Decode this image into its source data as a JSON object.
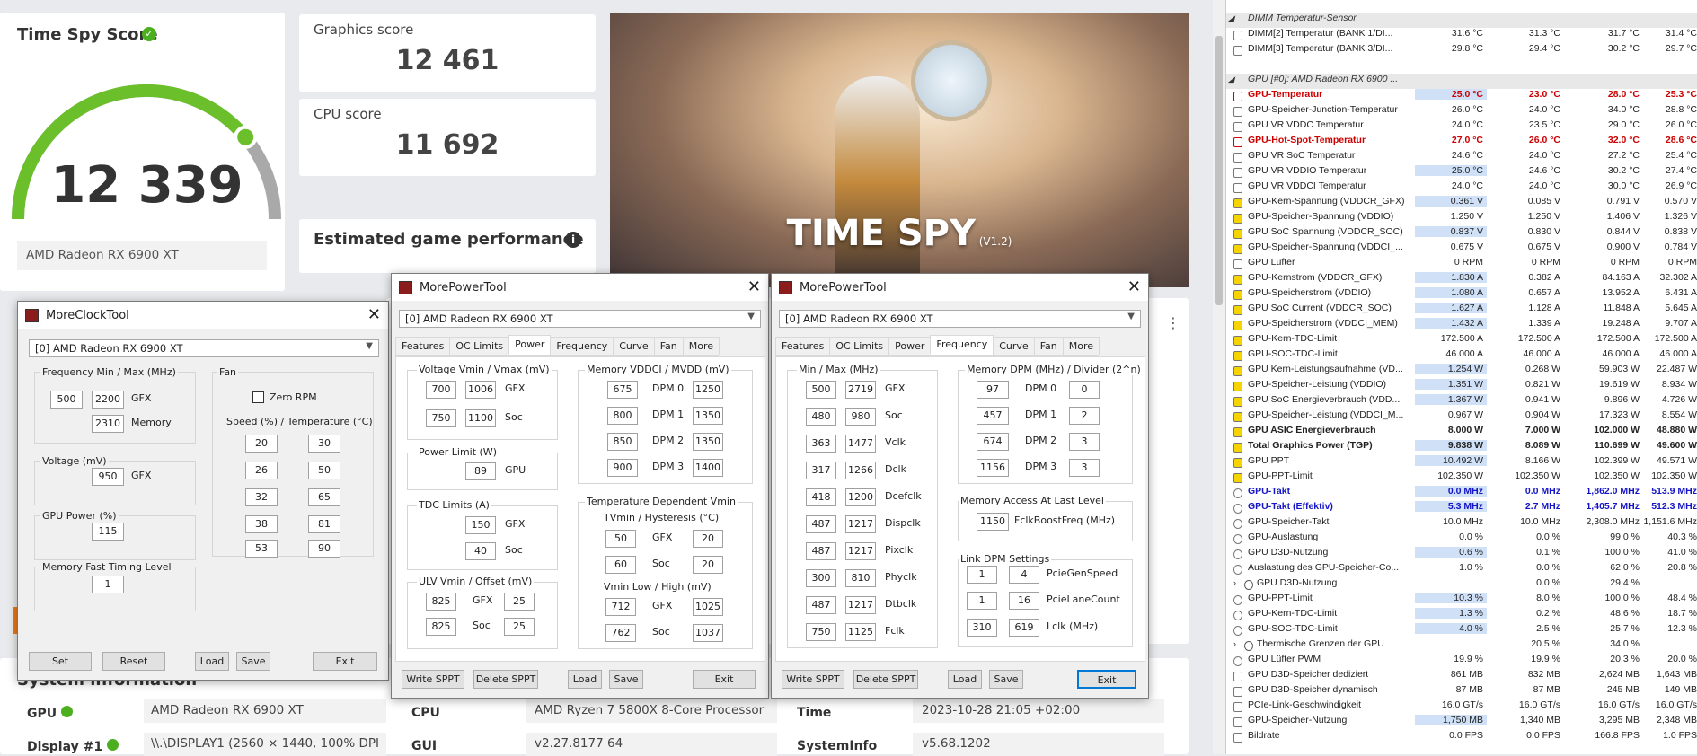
{
  "score": {
    "title": "Time Spy Score",
    "value": "12 339",
    "gpu": "AMD Radeon RX 6900 XT",
    "gauge_fraction": 0.78
  },
  "graphics": {
    "label": "Graphics score",
    "value": "12 461"
  },
  "cpu": {
    "label": "CPU score",
    "value": "11 692"
  },
  "estimate": {
    "label": "Estimated game performance"
  },
  "banner": {
    "title": "TIME SPY",
    "version": "(V1.2)"
  },
  "sysinfo": {
    "title": "System information",
    "rows": [
      {
        "k": "GPU",
        "v": "AMD Radeon RX 6900 XT",
        "k2": "CPU",
        "v2": "AMD Ryzen 7 5800X 8-Core Processor",
        "k3": "Time",
        "v3": "2023-10-28 21:05 +02:00"
      },
      {
        "k": "Display #1",
        "v": "\\\\.\\DISPLAY1 (2560 × 1440, 100% DPI",
        "k2": "GUI",
        "v2": "v2.27.8177 64",
        "k3": "SystemInfo",
        "v3": "v5.68.1202"
      }
    ]
  },
  "mct": {
    "title": "MoreClockTool",
    "device": "[0] AMD Radeon RX 6900 XT",
    "freq_title": "Frequency Min / Max (MHz)",
    "fmin": "500",
    "fmax": "2200",
    "gfx": "GFX",
    "mem": "2310",
    "memory": "Memory",
    "volt_title": "Voltage (mV)",
    "volt": "950",
    "power_title": "GPU Power (%)",
    "power": "115",
    "timing_title": "Memory Fast Timing Level",
    "timing": "1",
    "fan_title": "Fan",
    "zero_rpm": "Zero RPM",
    "spd_title": "Speed (%) / Temperature (°C)",
    "fan": [
      [
        "20",
        "30"
      ],
      [
        "26",
        "50"
      ],
      [
        "32",
        "65"
      ],
      [
        "38",
        "81"
      ],
      [
        "53",
        "90"
      ]
    ],
    "buttons": {
      "set": "Set",
      "reset": "Reset",
      "load": "Load",
      "save": "Save",
      "exit": "Exit"
    }
  },
  "mpt1": {
    "title": "MorePowerTool",
    "device": "[0] AMD Radeon RX 6900 XT",
    "tabs": [
      "Features",
      "OC Limits",
      "Power",
      "Frequency",
      "Curve",
      "Fan",
      "More"
    ],
    "volt_title": "Voltage Vmin / Vmax (mV)",
    "v": [
      [
        "700",
        "1006",
        "GFX"
      ],
      [
        "750",
        "1100",
        "Soc"
      ]
    ],
    "pl_title": "Power Limit (W)",
    "pl": "89",
    "gpu": "GPU",
    "tdc_title": "TDC Limits (A)",
    "tdc": [
      [
        "150",
        "GFX"
      ],
      [
        "40",
        "Soc"
      ]
    ],
    "ulv_title": "ULV Vmin / Offset (mV)",
    "ulv": [
      [
        "825",
        "GFX",
        "25"
      ],
      [
        "825",
        "Soc",
        "25"
      ]
    ],
    "mem_title": "Memory VDDCI / MVDD (mV)",
    "mem": [
      [
        "675",
        "DPM 0",
        "1250"
      ],
      [
        "800",
        "DPM 1",
        "1350"
      ],
      [
        "850",
        "DPM 2",
        "1350"
      ],
      [
        "900",
        "DPM 3",
        "1400"
      ]
    ],
    "tdv_title": "Temperature Dependent Vmin",
    "tv_title": "TVmin / Hysteresis (°C)",
    "tv": [
      [
        "50",
        "GFX",
        "20"
      ],
      [
        "60",
        "Soc",
        "20"
      ]
    ],
    "vl_title": "Vmin Low / High (mV)",
    "vl": [
      [
        "712",
        "GFX",
        "1025"
      ],
      [
        "762",
        "Soc",
        "1037"
      ]
    ],
    "buttons": {
      "write": "Write SPPT",
      "delete": "Delete SPPT",
      "load": "Load",
      "save": "Save",
      "exit": "Exit"
    }
  },
  "mpt2": {
    "title": "MorePowerTool",
    "device": "[0] AMD Radeon RX 6900 XT",
    "tabs": [
      "Features",
      "OC Limits",
      "Power",
      "Frequency",
      "Curve",
      "Fan",
      "More"
    ],
    "mm_title": "Min / Max (MHz)",
    "mm": [
      [
        "500",
        "2719",
        "GFX"
      ],
      [
        "480",
        "980",
        "Soc"
      ],
      [
        "363",
        "1477",
        "Vclk"
      ],
      [
        "317",
        "1266",
        "Dclk"
      ],
      [
        "418",
        "1200",
        "Dcefclk"
      ],
      [
        "487",
        "1217",
        "Dispclk"
      ],
      [
        "487",
        "1217",
        "Pixclk"
      ],
      [
        "300",
        "810",
        "Phyclk"
      ],
      [
        "487",
        "1217",
        "Dtbclk"
      ],
      [
        "750",
        "1125",
        "Fclk"
      ]
    ],
    "dpm_title": "Memory DPM (MHz) / Divider (2^n)",
    "dpm": [
      [
        "97",
        "DPM 0",
        "0"
      ],
      [
        "457",
        "DPM 1",
        "2"
      ],
      [
        "674",
        "DPM 2",
        "3"
      ],
      [
        "1156",
        "DPM 3",
        "3"
      ]
    ],
    "acc_title": "Memory Access At Last Level",
    "acc": "1150",
    "acc_lbl": "FclkBoostFreq (MHz)",
    "link_title": "Link DPM Settings",
    "link": [
      [
        "1",
        "4",
        "PcieGenSpeed"
      ],
      [
        "1",
        "16",
        "PcieLaneCount"
      ],
      [
        "310",
        "619",
        "Lclk (MHz)"
      ]
    ],
    "buttons": {
      "write": "Write SPPT",
      "delete": "Delete SPPT",
      "load": "Load",
      "save": "Save",
      "exit": "Exit"
    }
  },
  "hwinfo": [
    {
      "n": "DIMM Temperatur-Sensor",
      "hdr": true
    },
    {
      "n": "DIMM[2] Temperatur (BANK 1/DI...",
      "a": "31.6 °C",
      "b": "31.3 °C",
      "c": "31.7 °C",
      "d": "31.4 °C"
    },
    {
      "n": "DIMM[3] Temperatur (BANK 3/DI...",
      "a": "29.8 °C",
      "b": "29.4 °C",
      "c": "30.2 °C",
      "d": "29.7 °C"
    },
    {
      "n": "",
      "gap": true
    },
    {
      "n": "GPU [#0]: AMD Radeon RX 6900 ...",
      "hdr": true
    },
    {
      "n": "GPU-Temperatur",
      "a": "25.0 °C",
      "b": "23.0 °C",
      "c": "28.0 °C",
      "d": "25.3 °C",
      "s": "red",
      "h": 1
    },
    {
      "n": "GPU-Speicher-Junction-Temperatur",
      "a": "26.0 °C",
      "b": "24.0 °C",
      "c": "34.0 °C",
      "d": "28.8 °C"
    },
    {
      "n": "GPU VR VDDC Temperatur",
      "a": "24.0 °C",
      "b": "23.5 °C",
      "c": "29.0 °C",
      "d": "26.0 °C"
    },
    {
      "n": "GPU-Hot-Spot-Temperatur",
      "a": "27.0 °C",
      "b": "26.0 °C",
      "c": "32.0 °C",
      "d": "28.6 °C",
      "s": "red"
    },
    {
      "n": "GPU VR SoC Temperatur",
      "a": "24.6 °C",
      "b": "24.0 °C",
      "c": "27.2 °C",
      "d": "25.4 °C"
    },
    {
      "n": "GPU VR VDDIO Temperatur",
      "a": "25.0 °C",
      "b": "24.6 °C",
      "c": "30.2 °C",
      "d": "27.4 °C",
      "h": 1
    },
    {
      "n": "GPU VR VDDCI Temperatur",
      "a": "24.0 °C",
      "b": "24.0 °C",
      "c": "30.0 °C",
      "d": "26.9 °C"
    },
    {
      "n": "GPU-Kern-Spannung (VDDCR_GFX)",
      "a": "0.361 V",
      "b": "0.085 V",
      "c": "0.791 V",
      "d": "0.570 V",
      "h": 1
    },
    {
      "n": "GPU-Speicher-Spannung (VDDIO)",
      "a": "1.250 V",
      "b": "1.250 V",
      "c": "1.406 V",
      "d": "1.326 V"
    },
    {
      "n": "GPU SoC Spannung (VDDCR_SOC)",
      "a": "0.837 V",
      "b": "0.830 V",
      "c": "0.844 V",
      "d": "0.838 V",
      "h": 1
    },
    {
      "n": "GPU-Speicher-Spannung (VDDCI_...",
      "a": "0.675 V",
      "b": "0.675 V",
      "c": "0.900 V",
      "d": "0.784 V"
    },
    {
      "n": "GPU Lüfter",
      "a": "0 RPM",
      "b": "0 RPM",
      "c": "0 RPM",
      "d": "0 RPM"
    },
    {
      "n": "GPU-Kernstrom (VDDCR_GFX)",
      "a": "1.830 A",
      "b": "0.382 A",
      "c": "84.163 A",
      "d": "32.302 A",
      "h": 1
    },
    {
      "n": "GPU-Speicherstrom (VDDIO)",
      "a": "1.080 A",
      "b": "0.657 A",
      "c": "13.952 A",
      "d": "6.431 A",
      "h": 1
    },
    {
      "n": "GPU SoC Current (VDDCR_SOC)",
      "a": "1.627 A",
      "b": "1.128 A",
      "c": "11.848 A",
      "d": "5.645 A",
      "h": 1
    },
    {
      "n": "GPU-Speicherstrom (VDDCI_MEM)",
      "a": "1.432 A",
      "b": "1.339 A",
      "c": "19.248 A",
      "d": "9.707 A",
      "h": 1
    },
    {
      "n": "GPU-Kern-TDC-Limit",
      "a": "172.500 A",
      "b": "172.500 A",
      "c": "172.500 A",
      "d": "172.500 A"
    },
    {
      "n": "GPU-SOC-TDC-Limit",
      "a": "46.000 A",
      "b": "46.000 A",
      "c": "46.000 A",
      "d": "46.000 A"
    },
    {
      "n": "GPU Kern-Leistungsaufnahme (VD...",
      "a": "1.254 W",
      "b": "0.268 W",
      "c": "59.903 W",
      "d": "22.487 W",
      "h": 1
    },
    {
      "n": "GPU-Speicher-Leistung (VDDIO)",
      "a": "1.351 W",
      "b": "0.821 W",
      "c": "19.619 W",
      "d": "8.934 W",
      "h": 1
    },
    {
      "n": "GPU SoC Energieverbrauch (VDD...",
      "a": "1.367 W",
      "b": "0.941 W",
      "c": "9.896 W",
      "d": "4.726 W",
      "h": 1
    },
    {
      "n": "GPU-Speicher-Leistung (VDDCI_M...",
      "a": "0.967 W",
      "b": "0.904 W",
      "c": "17.323 W",
      "d": "8.554 W"
    },
    {
      "n": "GPU ASIC Energieverbrauch",
      "a": "8.000 W",
      "b": "7.000 W",
      "c": "102.000 W",
      "d": "48.880 W",
      "s": "bold"
    },
    {
      "n": "Total Graphics Power (TGP)",
      "a": "9.838 W",
      "b": "8.089 W",
      "c": "110.699 W",
      "d": "49.600 W",
      "s": "bold",
      "h": 1
    },
    {
      "n": "GPU PPT",
      "a": "10.492 W",
      "b": "8.166 W",
      "c": "102.399 W",
      "d": "49.571 W",
      "h": 1
    },
    {
      "n": "GPU-PPT-Limit",
      "a": "102.350 W",
      "b": "102.350 W",
      "c": "102.350 W",
      "d": "102.350 W"
    },
    {
      "n": "GPU-Takt",
      "a": "0.0 MHz",
      "b": "0.0 MHz",
      "c": "1,862.0 MHz",
      "d": "513.9 MHz",
      "s": "blue",
      "h": 1
    },
    {
      "n": "GPU-Takt (Effektiv)",
      "a": "5.3 MHz",
      "b": "2.7 MHz",
      "c": "1,405.7 MHz",
      "d": "512.3 MHz",
      "s": "blue",
      "h": 1
    },
    {
      "n": "GPU-Speicher-Takt",
      "a": "10.0 MHz",
      "b": "10.0 MHz",
      "c": "2,308.0 MHz",
      "d": "1,151.6 MHz"
    },
    {
      "n": "GPU-Auslastung",
      "a": "0.0 %",
      "b": "0.0 %",
      "c": "99.0 %",
      "d": "40.3 %"
    },
    {
      "n": "GPU D3D-Nutzung",
      "a": "0.6 %",
      "b": "0.1 %",
      "c": "100.0 %",
      "d": "41.0 %",
      "h": 1
    },
    {
      "n": "Auslastung des GPU-Speicher-Co...",
      "a": "1.0 %",
      "b": "0.0 %",
      "c": "62.0 %",
      "d": "20.8 %"
    },
    {
      "n": "GPU D3D-Nutzung",
      "a": "",
      "b": "0.0 %",
      "c": "29.4 %",
      "d": "",
      "exp": true
    },
    {
      "n": "GPU-PPT-Limit",
      "a": "10.3 %",
      "b": "8.0 %",
      "c": "100.0 %",
      "d": "48.4 %",
      "h": 1
    },
    {
      "n": "GPU-Kern-TDC-Limit",
      "a": "1.3 %",
      "b": "0.2 %",
      "c": "48.6 %",
      "d": "18.7 %",
      "h": 1
    },
    {
      "n": "GPU-SOC-TDC-Limit",
      "a": "4.0 %",
      "b": "2.5 %",
      "c": "25.7 %",
      "d": "12.3 %",
      "h": 1
    },
    {
      "n": "Thermische Grenzen der GPU",
      "a": "",
      "b": "20.5 %",
      "c": "34.0 %",
      "d": "",
      "exp": true
    },
    {
      "n": "GPU Lüfter PWM",
      "a": "19.9 %",
      "b": "19.9 %",
      "c": "20.3 %",
      "d": "20.0 %"
    },
    {
      "n": "GPU D3D-Speicher dediziert",
      "a": "861 MB",
      "b": "832 MB",
      "c": "2,624 MB",
      "d": "1,643 MB"
    },
    {
      "n": "GPU D3D-Speicher dynamisch",
      "a": "87 MB",
      "b": "87 MB",
      "c": "245 MB",
      "d": "149 MB"
    },
    {
      "n": "PCIe-Link-Geschwindigkeit",
      "a": "16.0 GT/s",
      "b": "16.0 GT/s",
      "c": "16.0 GT/s",
      "d": "16.0 GT/s"
    },
    {
      "n": "GPU-Speicher-Nutzung",
      "a": "1,750 MB",
      "b": "1,340 MB",
      "c": "3,295 MB",
      "d": "2,348 MB",
      "h": 1
    },
    {
      "n": "Bildrate",
      "a": "0.0 FPS",
      "b": "0.0 FPS",
      "c": "166.8 FPS",
      "d": "1.0 FPS"
    }
  ]
}
